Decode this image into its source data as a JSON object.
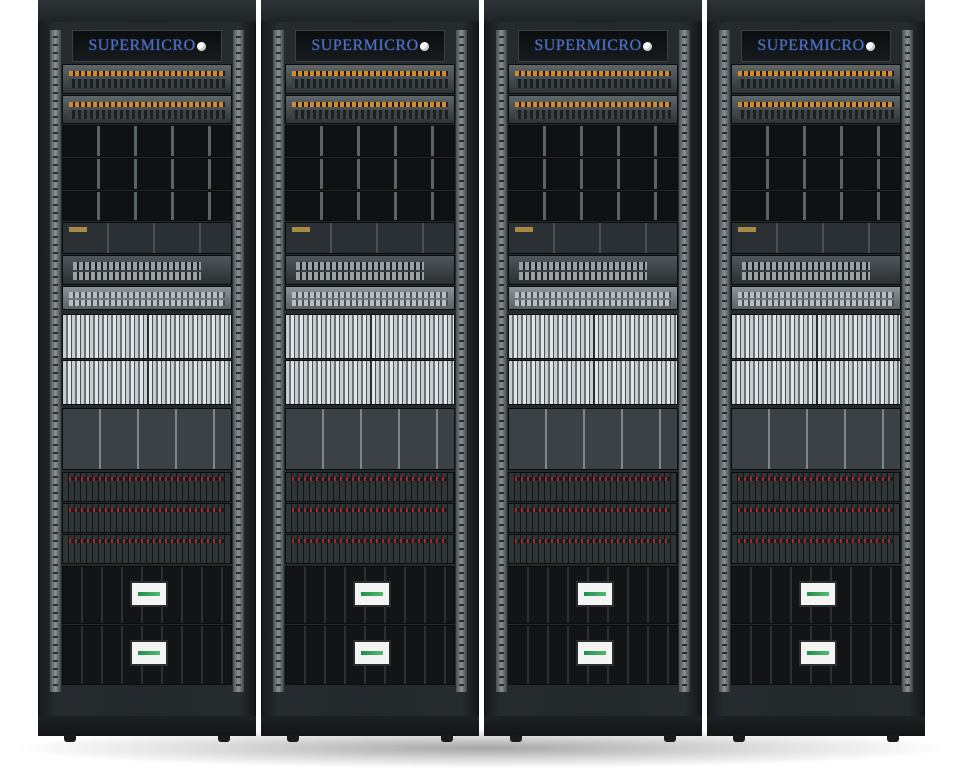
{
  "scene": {
    "description_free": true,
    "rack_brand": "SUPERMICRO",
    "rack_count": 4,
    "colors": {
      "rack_body": "#23282b",
      "logo_text": "#4a6fc8",
      "accent_orange": "#d48a2a",
      "accent_red": "#a8262b",
      "lcd_green": "#1e8f4e"
    }
  },
  "racks": [
    {
      "logo": "SUPERMICRO"
    },
    {
      "logo": "SUPERMICRO"
    },
    {
      "logo": "SUPERMICRO"
    },
    {
      "logo": "SUPERMICRO"
    }
  ]
}
